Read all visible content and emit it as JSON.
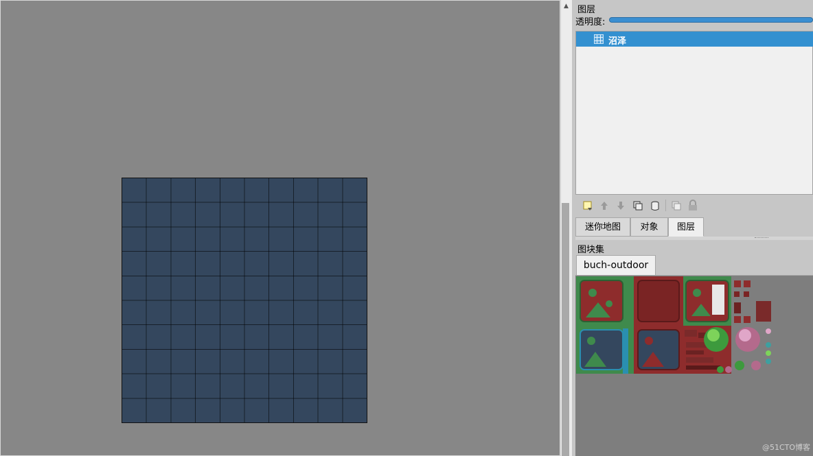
{
  "layers_panel": {
    "title": "图层",
    "opacity_label": "透明度:",
    "opacity_value": 1.0,
    "layers": [
      {
        "name": "沼泽",
        "selected": true,
        "type_icon": "tile-layer-icon"
      }
    ]
  },
  "layer_toolbar": {
    "icons": [
      "new-layer-icon",
      "raise-layer-icon",
      "lower-layer-icon",
      "duplicate-layer-icon",
      "delete-layer-icon",
      "toggle-others-icon",
      "lock-icon"
    ]
  },
  "dock_tabs": [
    {
      "label": "迷你地图",
      "active": false
    },
    {
      "label": "对象",
      "active": false
    },
    {
      "label": "图层",
      "active": true
    }
  ],
  "tileset_panel": {
    "title": "图块集",
    "tabs": [
      {
        "label": "buch-outdoor",
        "active": true
      }
    ]
  },
  "map": {
    "columns": 10,
    "rows": 10
  },
  "watermark": "@51CTO博客",
  "colors": {
    "canvas_bg": "#878787",
    "map_fill": "#34475e",
    "selection": "#3390d0",
    "slider": "#3b8fd1"
  }
}
